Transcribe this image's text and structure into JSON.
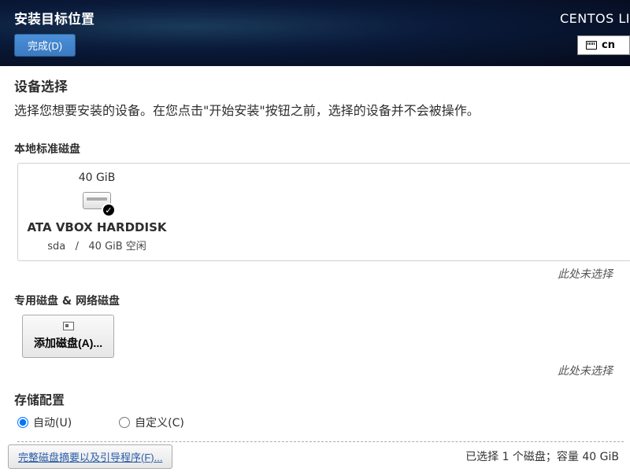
{
  "header": {
    "title": "安装目标位置",
    "done_label": "完成(D)",
    "distro": "CENTOS LI",
    "lang": "cn"
  },
  "device": {
    "title": "设备选择",
    "desc": "选择您想要安装的设备。在您点击\"开始安装\"按钮之前，选择的设备并不会被操作。"
  },
  "local_disks": {
    "title": "本地标准磁盘",
    "items": [
      {
        "size": "40 GiB",
        "name": "ATA VBOX HARDDISK",
        "dev": "sda",
        "sep": "/",
        "free": "40 GiB 空闲"
      }
    ],
    "footnote": "此处未选择"
  },
  "special": {
    "title": "专用磁盘 & 网络磁盘",
    "add_label": "添加磁盘(A)...",
    "footnote": "此处未选择"
  },
  "storage": {
    "title": "存储配置",
    "auto": "自动(U)",
    "custom": "自定义(C)"
  },
  "bottom": {
    "summary": "完整磁盘摘要以及引导程序(F)...",
    "status": "已选择 1 个磁盘；容量 40 GiB"
  }
}
